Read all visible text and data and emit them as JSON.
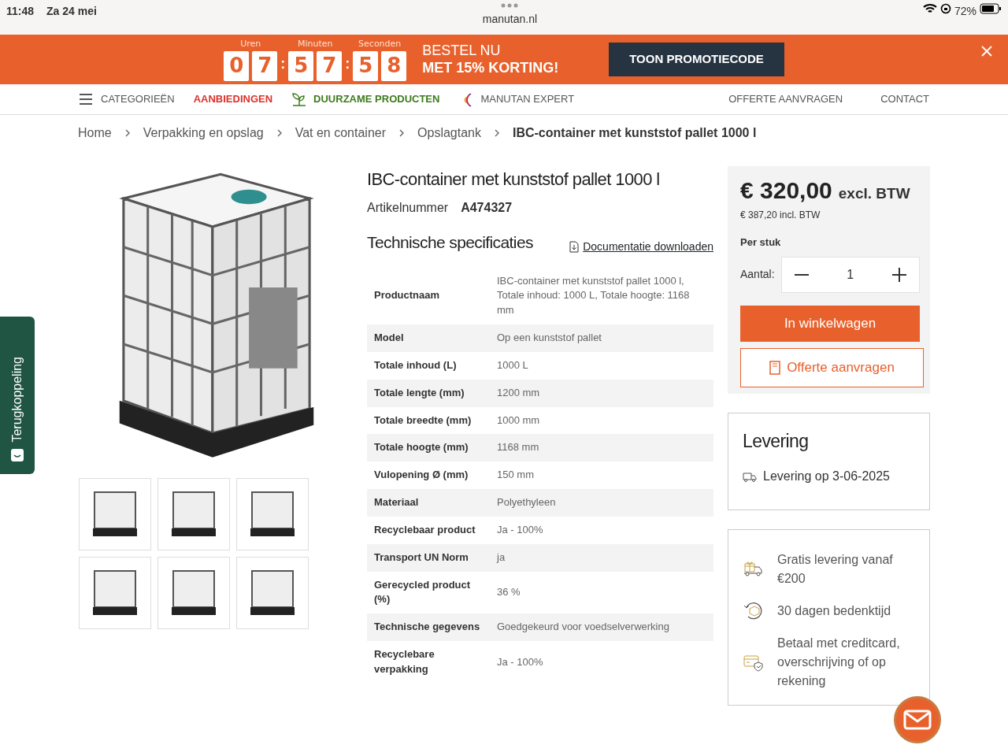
{
  "status_bar": {
    "time": "11:48",
    "date": "Za 24 mei",
    "url": "manutan.nl",
    "battery": "72%"
  },
  "promo": {
    "countdown": [
      {
        "label": "Uren",
        "digits": [
          "0",
          "7"
        ]
      },
      {
        "label": "Minuten",
        "digits": [
          "5",
          "7"
        ]
      },
      {
        "label": "Seconden",
        "digits": [
          "5",
          "8"
        ]
      }
    ],
    "separator": ":",
    "headline": [
      "BESTEL NU",
      "MET 15% KORTING!"
    ],
    "button": "TOON PROMOTIECODE"
  },
  "nav": {
    "left": [
      {
        "label": "CATEGORIEËN",
        "kind": "menu",
        "color": "#555555"
      },
      {
        "label": "AANBIEDINGEN",
        "kind": "plain",
        "color": "#d9322b"
      },
      {
        "label": "DUURZAME PRODUCTEN",
        "kind": "plant",
        "color": "#3d7a1e"
      },
      {
        "label": "MANUTAN EXPERT",
        "kind": "expert",
        "color": "#555555"
      }
    ],
    "right": [
      "OFFERTE AANVRAGEN",
      "CONTACT"
    ]
  },
  "breadcrumb": [
    {
      "label": "Home",
      "current": false
    },
    {
      "label": "Verpakking en opslag",
      "current": false
    },
    {
      "label": "Vat en container",
      "current": false
    },
    {
      "label": "Opslagtank",
      "current": false
    },
    {
      "label": "IBC-container met kunststof pallet 1000 l",
      "current": true
    }
  ],
  "product": {
    "title": "IBC-container met kunststof pallet 1000 l",
    "article_label": "Artikelnummer",
    "article_number": "A474327",
    "specs_title": "Technische specificaties",
    "doc_link": "Documentatie downloaden",
    "specs": [
      {
        "name": "Productnaam",
        "value": "IBC-container met kunststof pallet 1000 l, Totale inhoud: 1000 L, Totale hoogte: 1168 mm"
      },
      {
        "name": "Model",
        "value": "Op een kunststof pallet"
      },
      {
        "name": "Totale inhoud (L)",
        "value": "1000 L"
      },
      {
        "name": "Totale lengte (mm)",
        "value": "1200 mm"
      },
      {
        "name": "Totale breedte (mm)",
        "value": "1000 mm"
      },
      {
        "name": "Totale hoogte (mm)",
        "value": "1168 mm"
      },
      {
        "name": "Vulopening Ø (mm)",
        "value": "150 mm"
      },
      {
        "name": "Materiaal",
        "value": "Polyethyleen"
      },
      {
        "name": "Recyclebaar product",
        "value": "Ja - 100%"
      },
      {
        "name": "Transport UN Norm",
        "value": "ja"
      },
      {
        "name": "Gerecycled product (%)",
        "value": "36 %"
      },
      {
        "name": "Technische gegevens",
        "value": "Goedgekeurd voor voedselverwerking"
      },
      {
        "name": "Recyclebare verpakking",
        "value": "Ja - 100%"
      }
    ]
  },
  "price": {
    "amount": "€ 320,00",
    "excl": "excl. BTW",
    "incl": "€ 387,20 incl. BTW",
    "per_unit": "Per stuk",
    "quantity_label": "Aantal:",
    "quantity": "1",
    "cart_button": "In winkelwagen",
    "quote_button": "Offerte aanvragen"
  },
  "delivery": {
    "title": "Levering",
    "text": "Levering op 3-06-2025"
  },
  "benefits": [
    {
      "kind": "gift",
      "text": "Gratis levering vanaf €200"
    },
    {
      "kind": "return",
      "text": "30 dagen bedenktijd"
    },
    {
      "kind": "payment",
      "text": "Betaal met creditcard, overschrijving of op rekening"
    }
  ],
  "feedback_tab": "Terugkoppeling"
}
